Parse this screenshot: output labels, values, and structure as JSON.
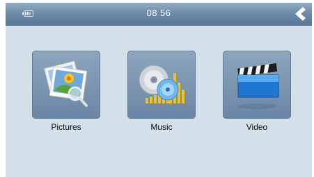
{
  "status_bar": {
    "time": "08 56",
    "battery_icon": "battery-icon",
    "back_icon": "back-arrow-icon"
  },
  "menu": {
    "items": [
      {
        "label": "Pictures",
        "icon": "pictures-icon"
      },
      {
        "label": "Music",
        "icon": "music-icon"
      },
      {
        "label": "Video",
        "icon": "video-icon"
      }
    ]
  },
  "colors": {
    "background": "#d3e0ea",
    "topbar": "#6e8caa",
    "tile": "#7a94b0"
  }
}
